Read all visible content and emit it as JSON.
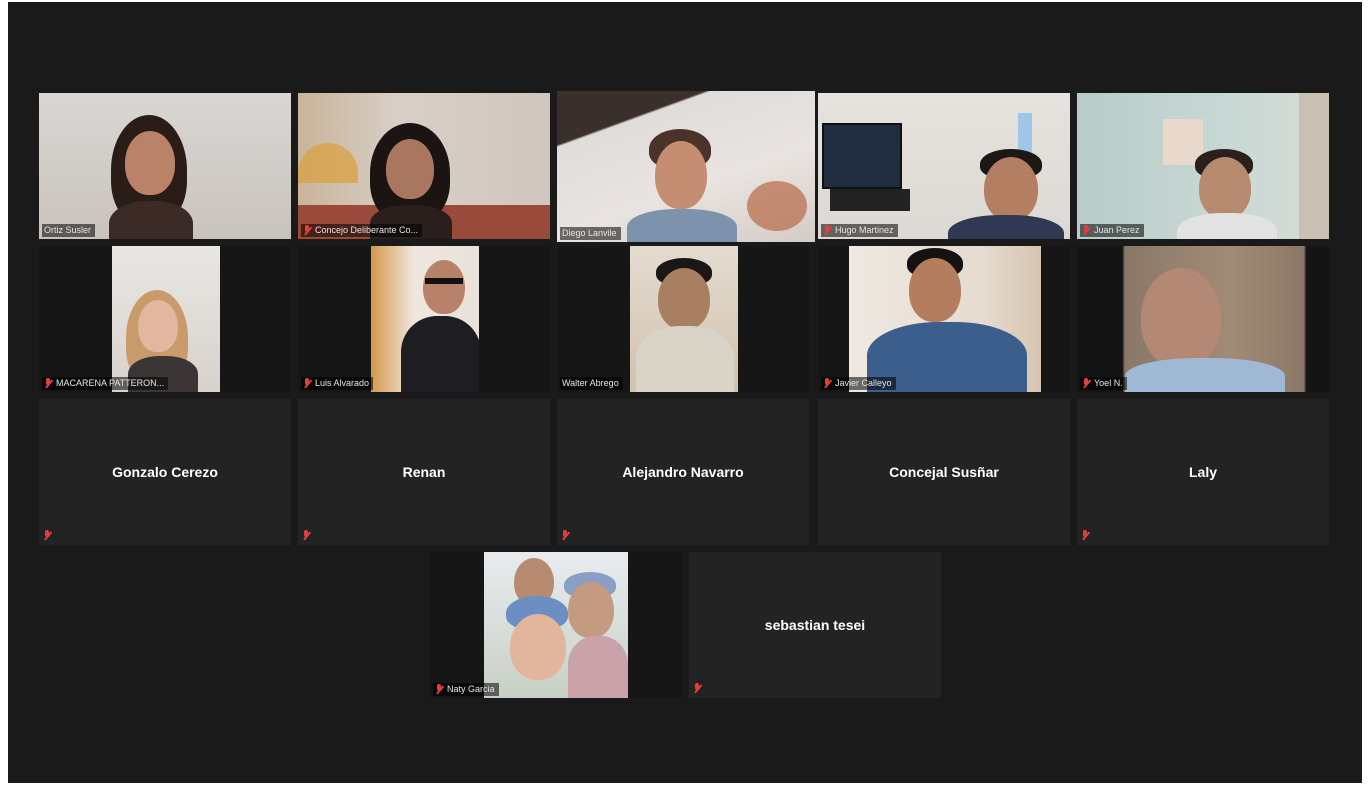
{
  "participants_row1": [
    {
      "name": "Ortiz Susler",
      "muted": false
    },
    {
      "name": "Concejo Deliberante Co...",
      "muted": true
    },
    {
      "name": "Diego Lanvile",
      "muted": false,
      "active_speaker": true
    },
    {
      "name": "Hugo Martinez",
      "muted": true
    },
    {
      "name": "Juan Perez",
      "muted": true
    }
  ],
  "participants_row2": [
    {
      "name": "MACARENA PATTERON...",
      "muted": true
    },
    {
      "name": "Luis Alvarado",
      "muted": true
    },
    {
      "name": "Walter Abrego",
      "muted": false
    },
    {
      "name": "Javier Calleyo",
      "muted": true
    },
    {
      "name": "Yoel N.",
      "muted": true
    }
  ],
  "participants_row3": [
    {
      "name": "Gonzalo Cerezo",
      "muted": true
    },
    {
      "name": "Renan",
      "muted": true
    },
    {
      "name": "Alejandro Navarro",
      "muted": true
    },
    {
      "name": "Concejal Susñar",
      "muted": true
    },
    {
      "name": "Laly",
      "muted": true
    }
  ],
  "participants_row4": [
    {
      "name": "Naty Garcia",
      "muted": true
    },
    {
      "name": "sebastian tesei",
      "muted": true
    }
  ],
  "colors": {
    "background": "#1a1a1a",
    "tile": "#232323",
    "active_speaker_border": "#c9e265",
    "muted_icon": "#e0403a"
  }
}
